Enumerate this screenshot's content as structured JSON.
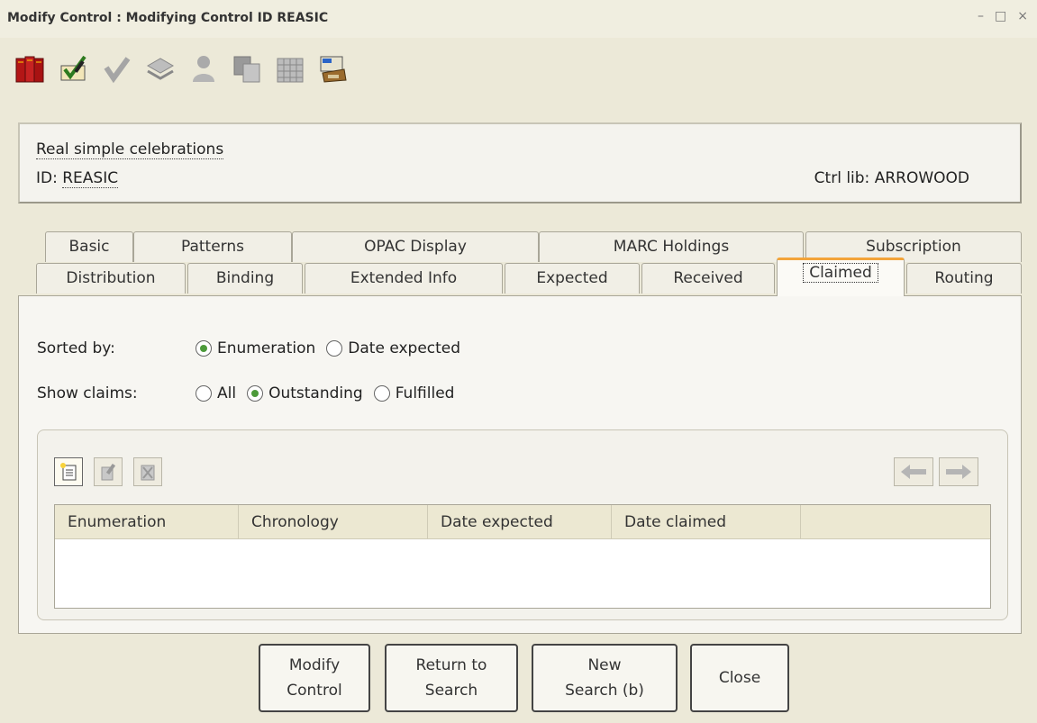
{
  "window": {
    "title": "Modify Control : Modifying Control ID  REASIC",
    "min": "–",
    "max": "□",
    "close": "×"
  },
  "toolbar": [
    "book-stack-icon",
    "checklist-pen-icon",
    "check-mark-icon",
    "stack-icon",
    "person-icon",
    "copy-icon",
    "grid-icon",
    "catalog-icon"
  ],
  "record": {
    "title": "Real simple celebrations",
    "id_label": "ID: ",
    "id_value": "REASIC",
    "ctrl_lib": "Ctrl lib: ARROWOOD"
  },
  "tabs": {
    "row1": [
      "Basic",
      "Patterns",
      "OPAC Display",
      "MARC Holdings",
      "Subscription"
    ],
    "row2": [
      "Distribution",
      "Binding",
      "Extended Info",
      "Expected",
      "Received",
      "Claimed",
      "Routing"
    ],
    "active": "Claimed"
  },
  "claimed": {
    "sorted_by_label": "Sorted by:",
    "sorted_opts": [
      "Enumeration",
      "Date expected"
    ],
    "sorted_selected": "Enumeration",
    "show_claims_label": "Show claims:",
    "show_opts": [
      "All",
      "Outstanding",
      "Fulfilled"
    ],
    "show_selected": "Outstanding",
    "columns": [
      "Enumeration",
      "Chronology",
      "Date expected",
      "Date claimed",
      ""
    ]
  },
  "buttons": {
    "modify": [
      "Modify",
      "Control"
    ],
    "return": [
      "Return to",
      "Search"
    ],
    "new_search": [
      "New",
      "Search (b)"
    ],
    "close": "Close"
  },
  "colors": {
    "accent_tab": "#f3a43a",
    "radio_checked": "#4c9a3a"
  }
}
